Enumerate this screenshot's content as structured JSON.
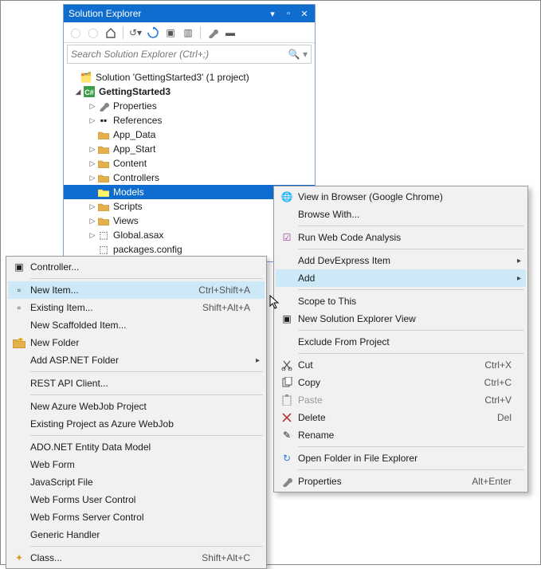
{
  "panel": {
    "title": "Solution Explorer",
    "search_placeholder": "Search Solution Explorer (Ctrl+;)",
    "solution_line": "Solution 'GettingStarted3' (1 project)",
    "project": "GettingStarted3",
    "nodes": {
      "properties": "Properties",
      "references": "References",
      "app_data": "App_Data",
      "app_start": "App_Start",
      "content": "Content",
      "controllers": "Controllers",
      "models": "Models",
      "scripts": "Scripts",
      "views": "Views",
      "global": "Global.asax",
      "packages": "packages.config"
    }
  },
  "context_menu": {
    "items": {
      "view_browser": "View in Browser (Google Chrome)",
      "browse_with": "Browse With...",
      "run_analysis": "Run Web Code Analysis",
      "add_dx": "Add DevExpress Item",
      "add": "Add",
      "scope": "Scope to This",
      "new_view": "New Solution Explorer View",
      "exclude": "Exclude From Project",
      "cut": "Cut",
      "copy": "Copy",
      "paste": "Paste",
      "delete": "Delete",
      "rename": "Rename",
      "open_folder": "Open Folder in File Explorer",
      "properties": "Properties"
    },
    "shortcuts": {
      "cut": "Ctrl+X",
      "copy": "Ctrl+C",
      "paste": "Ctrl+V",
      "delete": "Del",
      "properties": "Alt+Enter"
    }
  },
  "add_menu": {
    "items": {
      "controller": "Controller...",
      "new_item": "New Item...",
      "existing_item": "Existing Item...",
      "scaffold": "New Scaffolded Item...",
      "new_folder": "New Folder",
      "asp_folder": "Add ASP.NET Folder",
      "rest": "REST API Client...",
      "azure_new": "New Azure WebJob Project",
      "azure_existing": "Existing Project as Azure WebJob",
      "ado": "ADO.NET Entity Data Model",
      "webform": "Web Form",
      "js": "JavaScript File",
      "wf_user": "Web Forms User Control",
      "wf_server": "Web Forms Server Control",
      "generic": "Generic Handler",
      "class": "Class..."
    },
    "shortcuts": {
      "new_item": "Ctrl+Shift+A",
      "existing_item": "Shift+Alt+A",
      "class": "Shift+Alt+C"
    }
  }
}
